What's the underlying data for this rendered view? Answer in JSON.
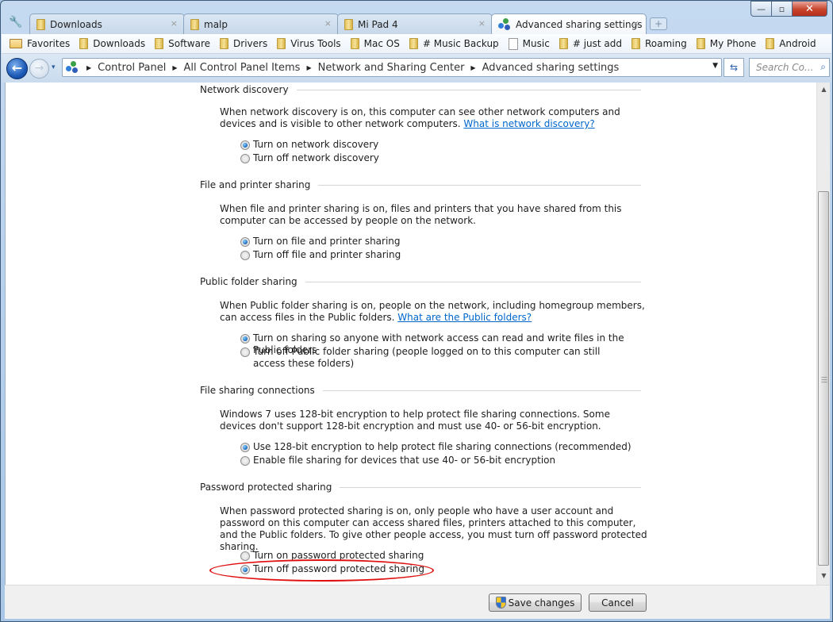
{
  "window": {
    "controls": {
      "minimize": "—",
      "maximize": "▫",
      "close": "✕"
    }
  },
  "tabs": [
    {
      "label": "Downloads",
      "icon": "folder-icon",
      "active": false
    },
    {
      "label": "malp",
      "icon": "folder-icon",
      "active": false
    },
    {
      "label": "Mi Pad 4",
      "icon": "folder-icon",
      "active": false
    },
    {
      "label": "Advanced sharing settings",
      "icon": "network-icon",
      "active": true
    }
  ],
  "tab_close_glyph": "×",
  "new_tab_glyph": "+",
  "wrench_glyph": "🔧",
  "bookmarks": [
    {
      "label": "Favorites",
      "icon": "folder-open-icon"
    },
    {
      "label": "Downloads",
      "icon": "folder-icon"
    },
    {
      "label": "Software",
      "icon": "folder-icon"
    },
    {
      "label": "Drivers",
      "icon": "folder-icon"
    },
    {
      "label": "Virus Tools",
      "icon": "folder-icon"
    },
    {
      "label": "Mac OS",
      "icon": "folder-icon"
    },
    {
      "label": "# Music Backup",
      "icon": "folder-icon"
    },
    {
      "label": "Music",
      "icon": "page-icon"
    },
    {
      "label": "# just add",
      "icon": "folder-icon"
    },
    {
      "label": "Roaming",
      "icon": "folder-icon"
    },
    {
      "label": "My Phone",
      "icon": "folder-icon"
    },
    {
      "label": "Android",
      "icon": "folder-icon"
    }
  ],
  "nav": {
    "back_glyph": "←",
    "forward_glyph": "→",
    "history_glyph": "▾",
    "breadcrumb": [
      "Control Panel",
      "All Control Panel Items",
      "Network and Sharing Center",
      "Advanced sharing settings"
    ],
    "crumb_sep": "▶",
    "dropdown_glyph": "▼",
    "refresh_glyph": "⇆",
    "search_placeholder": "Search Co...",
    "search_glyph": "⌕"
  },
  "sections": [
    {
      "title": "Network discovery",
      "description": "When network discovery is on, this computer can see other network computers and devices and is visible to other network computers.",
      "link": "What is network discovery?",
      "options": [
        {
          "label": "Turn on network discovery",
          "checked": true
        },
        {
          "label": "Turn off network discovery",
          "checked": false
        }
      ]
    },
    {
      "title": "File and printer sharing",
      "description": "When file and printer sharing is on, files and printers that you have shared from this computer can be accessed by people on the network.",
      "options": [
        {
          "label": "Turn on file and printer sharing",
          "checked": true
        },
        {
          "label": "Turn off file and printer sharing",
          "checked": false
        }
      ]
    },
    {
      "title": "Public folder sharing",
      "description": "When Public folder sharing is on, people on the network, including homegroup members, can access files in the Public folders.",
      "link": "What are the Public folders?",
      "options": [
        {
          "label": "Turn on sharing so anyone with network access can read and write files in the Public folders",
          "checked": true
        },
        {
          "label": "Turn off Public folder sharing (people logged on to this computer can still access these folders)",
          "checked": false
        }
      ]
    },
    {
      "title": "File sharing connections",
      "description": "Windows 7 uses 128-bit encryption to help protect file sharing connections. Some devices don't support 128-bit encryption and must use 40- or 56-bit encryption.",
      "options": [
        {
          "label": "Use 128-bit encryption to help protect file sharing connections (recommended)",
          "checked": true
        },
        {
          "label": "Enable file sharing for devices that use 40- or 56-bit encryption",
          "checked": false
        }
      ]
    },
    {
      "title": "Password protected sharing",
      "description": "When password protected sharing is on, only people who have a user account and password on this computer can access shared files, printers attached to this computer, and the Public folders. To give other people access, you must turn off password protected sharing.",
      "options": [
        {
          "label": "Turn on password protected sharing",
          "checked": false
        },
        {
          "label": "Turn off password protected sharing",
          "checked": true
        }
      ]
    }
  ],
  "annotation": {
    "color": "#e01010",
    "target": "Turn off password protected sharing"
  },
  "scrollbar": {
    "up_glyph": "▲",
    "down_glyph": "▼",
    "grip_glyph": "≡",
    "position_fraction": 1.0
  },
  "footer": {
    "save_label": "Save changes",
    "cancel_label": "Cancel"
  }
}
